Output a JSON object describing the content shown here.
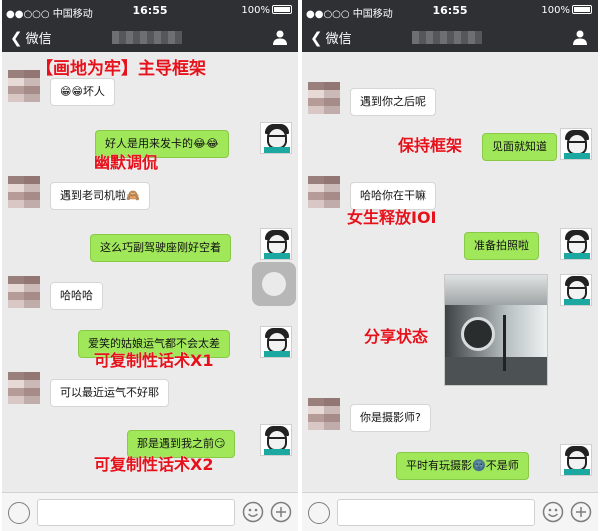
{
  "status_bar": {
    "carrier": "●●○○○ 中国移动",
    "time": "16:55",
    "battery": "100%"
  },
  "nav": {
    "back_label": "微信"
  },
  "left_chat": {
    "messages": [
      {
        "side": "in",
        "text": "😁😁坏人"
      },
      {
        "side": "out",
        "text": "好人是用来发卡的😂😂"
      },
      {
        "side": "in",
        "text": "遇到老司机啦🙈"
      },
      {
        "side": "out",
        "text": "这么巧副驾驶座刚好空着"
      },
      {
        "side": "in",
        "text": "哈哈哈"
      },
      {
        "side": "out",
        "text": "爱笑的姑娘运气都不会太差"
      },
      {
        "side": "in",
        "text": "可以最近运气不好耶"
      },
      {
        "side": "out",
        "text": "那是遇到我之前😏"
      }
    ],
    "overlays": [
      "【画地为牢】主导框架",
      "幽默调侃",
      "可复制性话术X1",
      "可复制性话术X2"
    ]
  },
  "right_chat": {
    "messages": [
      {
        "side": "in",
        "text": "遇到你之后呢"
      },
      {
        "side": "out",
        "text": "见面就知道"
      },
      {
        "side": "in",
        "text": "哈哈你在干嘛"
      },
      {
        "side": "out",
        "text": "准备拍照啦"
      },
      {
        "side": "in",
        "text": "你是摄影师?"
      },
      {
        "side": "out",
        "text": "平时有玩摄影🌚不是师"
      }
    ],
    "overlays": [
      "保持框架",
      "女生释放IOI",
      "分享状态"
    ]
  },
  "colors": {
    "header_bg": "#2e3034",
    "chat_bg": "#ebebeb",
    "outgoing_bubble": "#a0e75a",
    "incoming_bubble": "#ffffff",
    "annotation_red": "#e5111b"
  },
  "icons": [
    "back-chevron-icon",
    "person-icon",
    "voice-icon",
    "emoji-icon",
    "plus-icon"
  ]
}
